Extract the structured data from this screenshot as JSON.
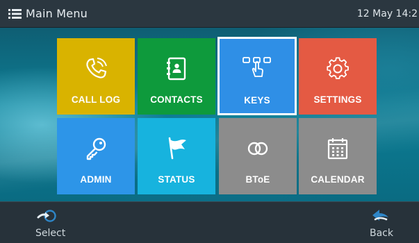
{
  "header": {
    "title": "Main Menu",
    "clock": "12 May 14:2",
    "menu_icon": "hamburger-menu-icon"
  },
  "tiles": [
    {
      "label": "CALL LOG",
      "icon": "phone-handset-icon",
      "color": "#d9b300",
      "selected": false
    },
    {
      "label": "CONTACTS",
      "icon": "address-book-icon",
      "color": "#0e9a3c",
      "selected": false
    },
    {
      "label": "KEYS",
      "icon": "key-press-icon",
      "color": "#2f8fe6",
      "selected": true
    },
    {
      "label": "SETTINGS",
      "icon": "gear-icon",
      "color": "#e45a43",
      "selected": false
    },
    {
      "label": "ADMIN",
      "icon": "key-icon",
      "color": "#2d95e8",
      "selected": false
    },
    {
      "label": "STATUS",
      "icon": "flag-icon",
      "color": "#17b3de",
      "selected": false
    },
    {
      "label": "BToE",
      "icon": "linked-rings-icon",
      "color": "#8c8c8c",
      "selected": false
    },
    {
      "label": "CALENDAR",
      "icon": "calendar-icon",
      "color": "#8c8c8c",
      "selected": false
    }
  ],
  "softkeys": {
    "left": {
      "label": "Select",
      "icon": "select-arrow-icon"
    },
    "right": {
      "label": "Back",
      "icon": "back-arrow-icon"
    }
  }
}
